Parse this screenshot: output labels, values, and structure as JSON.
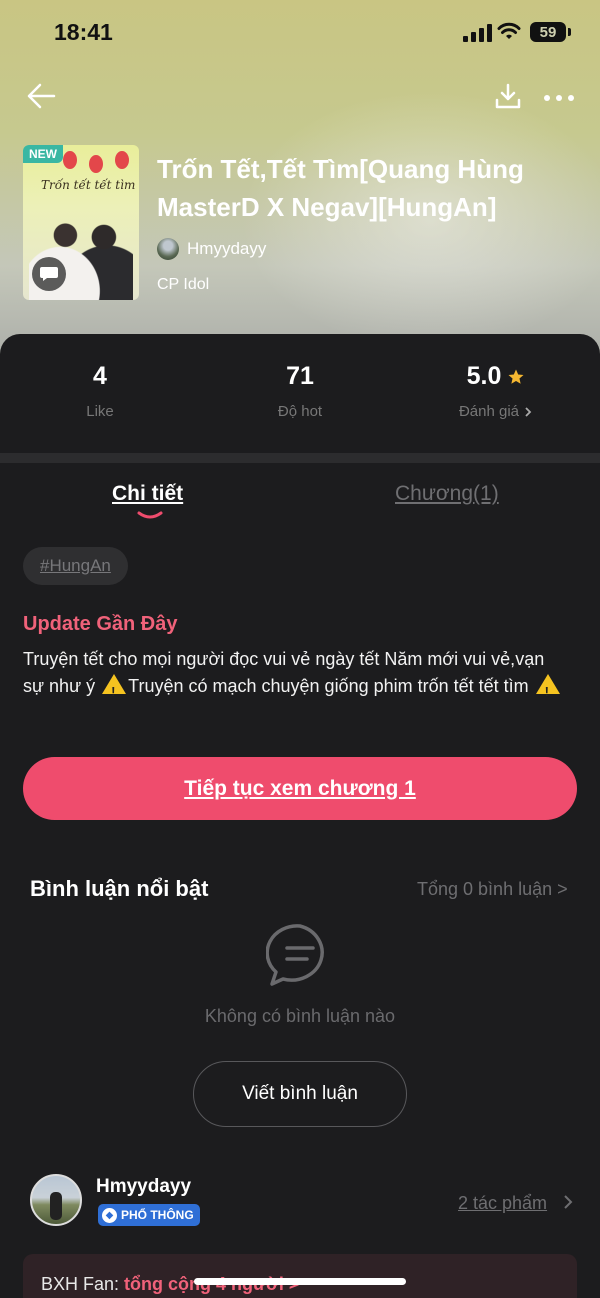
{
  "status_bar": {
    "time": "18:41",
    "battery": "59"
  },
  "book": {
    "badge": "NEW",
    "cover_title": "Trốn tết tết tìm",
    "title": "Trốn Tết,Tết Tìm[Quang Hùng MasterD X Negav][HungAn]",
    "author": "Hmyydayy",
    "category": "CP Idol"
  },
  "stats": [
    {
      "value": "4",
      "label": "Like"
    },
    {
      "value": "71",
      "label": "Độ hot"
    },
    {
      "value": "5.0",
      "label": "Đánh giá"
    }
  ],
  "tabs": [
    {
      "label": "Chi tiết"
    },
    {
      "label": "Chương(1)"
    }
  ],
  "tag": "#HungAn",
  "update": {
    "title": "Update Gần Đây",
    "desc_part1": "Truyện tết cho mọi người đọc vui vẻ ngày tết Năm mới vui vẻ,vạn sự như ý ",
    "desc_part2": "Truyện có mạch chuyện giống phim trốn tết tết tìm "
  },
  "cta_label": "Tiếp tục xem chương 1",
  "comments": {
    "title": "Bình luận nổi bật",
    "total": "Tổng 0 bình luận >",
    "empty": "Không có bình luận nào",
    "write": "Viết bình luận"
  },
  "author_card": {
    "name": "Hmyydayy",
    "badge": "PHỔ THÔNG",
    "works": "2 tác phẩm"
  },
  "fan": {
    "label": "BXH Fan: ",
    "accent": "tổng cộng 4 người >"
  },
  "colors": {
    "accent": "#ef4c6d",
    "star": "#f5b731",
    "badge_blue": "#2f6fd6"
  }
}
